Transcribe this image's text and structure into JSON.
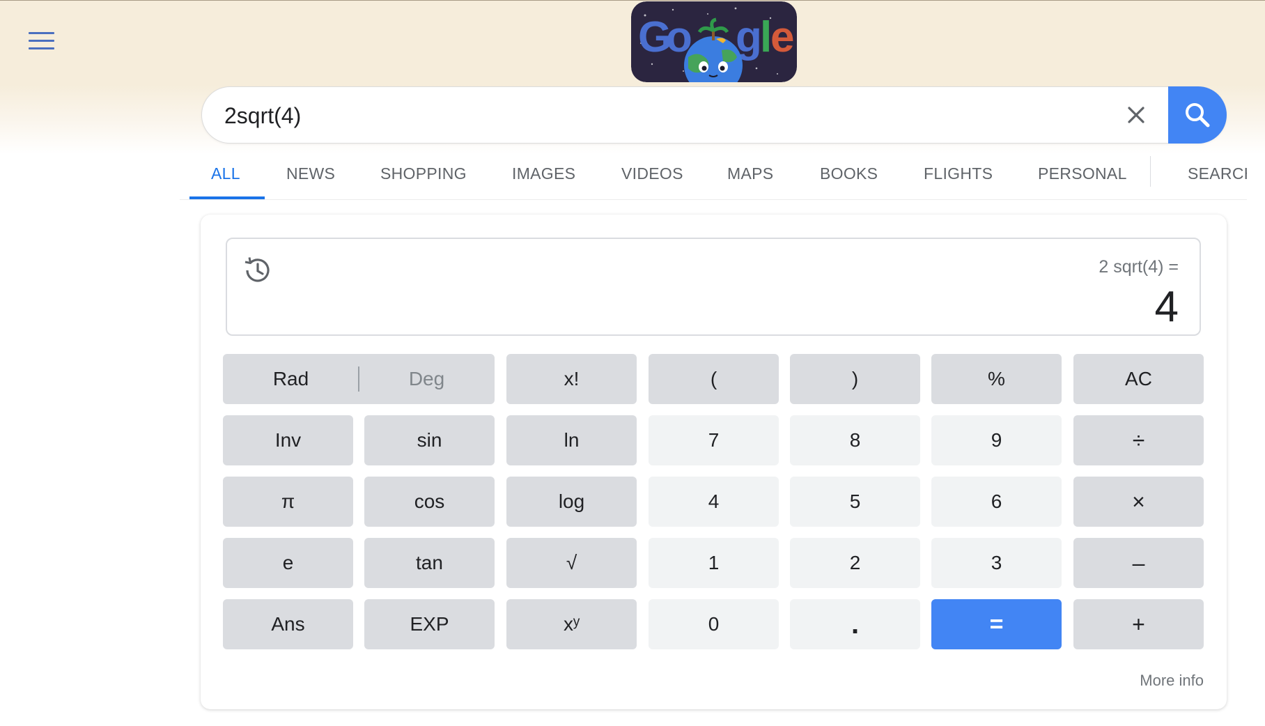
{
  "colors": {
    "accent": "#4285f4",
    "active_tab": "#1a73e8",
    "band": "#f6eddb"
  },
  "search": {
    "query": "2sqrt(4)"
  },
  "tabs": [
    {
      "label": "ALL"
    },
    {
      "label": "NEWS"
    },
    {
      "label": "SHOPPING"
    },
    {
      "label": "IMAGES"
    },
    {
      "label": "VIDEOS"
    },
    {
      "label": "MAPS"
    },
    {
      "label": "BOOKS"
    },
    {
      "label": "FLIGHTS"
    },
    {
      "label": "PERSONAL"
    },
    {
      "label": "SEARCH"
    }
  ],
  "calculator": {
    "expression": "2 sqrt(4) =",
    "result": "4",
    "mode": {
      "rad": "Rad",
      "deg": "Deg",
      "active": "Rad"
    },
    "keys": [
      [
        "x!",
        "(",
        ")",
        "%",
        "AC"
      ],
      [
        "Inv",
        "sin",
        "ln",
        "7",
        "8",
        "9",
        "÷"
      ],
      [
        "π",
        "cos",
        "log",
        "4",
        "5",
        "6",
        "×"
      ],
      [
        "e",
        "tan",
        "√",
        "1",
        "2",
        "3",
        "–"
      ],
      [
        "Ans",
        "EXP",
        "xʸ",
        "0",
        ".",
        "=",
        "+"
      ]
    ],
    "more_info": "More info"
  }
}
